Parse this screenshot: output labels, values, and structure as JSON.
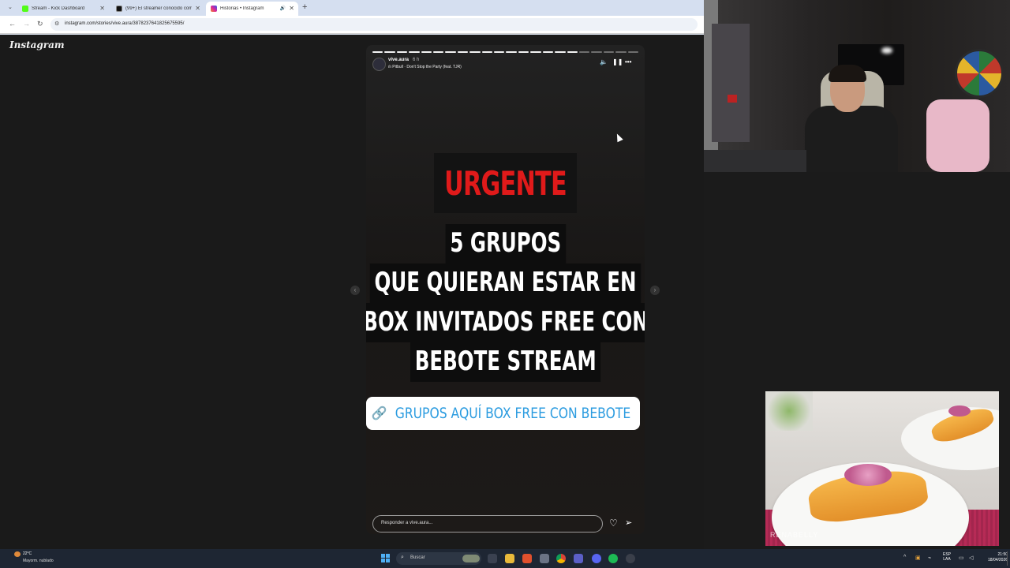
{
  "browser": {
    "tabs": [
      {
        "label": "Stream - Kick Dashboard",
        "color": "#53fc18"
      },
      {
        "label": "(99+) El streamer conocido com",
        "color": "#111111"
      },
      {
        "label": "Historias • Instagram",
        "color": "#d6249f"
      }
    ],
    "url": "instagram.com/stories/vive.aura/3878237641825675595/"
  },
  "instagram": {
    "logo": "Instagram",
    "story": {
      "username": "vive.aura",
      "time": "6 h",
      "song": "Pitbull · Don't Stop the Party (feat. TJR)",
      "urgent": "URGENTE",
      "headline": [
        "5 GRUPOS",
        "QUE QUIERAN ESTAR EN",
        "BOX INVITADOS FREE CON",
        "BEBOTE STREAM"
      ],
      "link_text": "GRUPOS AQUÍ BOX FREE CON BEBOTE",
      "segments_total": 22,
      "segments_done": 17
    },
    "reply_placeholder": "Responder a vive.aura...",
    "icons": [
      "mute-icon",
      "pause-icon",
      "more-icon",
      "heart-icon",
      "send-icon",
      "link-icon"
    ]
  },
  "food_watermark": "RENABELLY",
  "taskbar": {
    "weather_temp": "22°C",
    "weather_desc": "Mayorm. nublado",
    "search_placeholder": "Buscar",
    "lang_1": "ESP",
    "lang_2": "LAA",
    "time": "21:50",
    "date": "18/04/2026"
  },
  "colors": {
    "urgent_red": "#e01a1a",
    "link_blue": "#2c9ce0",
    "taskbar_bg": "#1e2633"
  }
}
